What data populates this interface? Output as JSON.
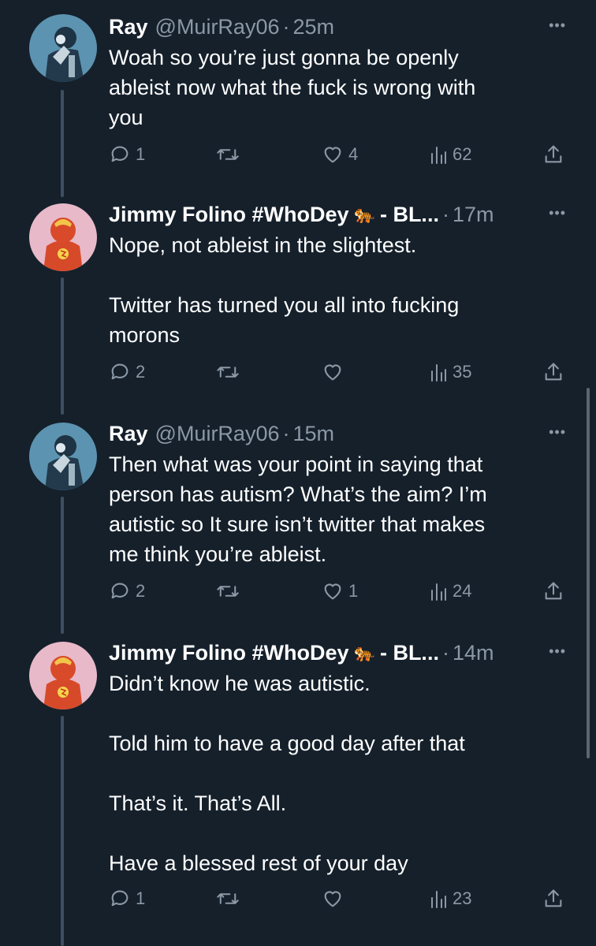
{
  "tweets": [
    {
      "name": "Ray",
      "handle": "@MuirRay06",
      "dot": "·",
      "time": "25m",
      "lines": [
        "Woah so you’re just gonna be openly",
        "ableist now what the fuck is wrong with",
        "you"
      ],
      "replies": "1",
      "retweets": "",
      "likes": "4",
      "views": "62"
    },
    {
      "name": "Jimmy Folino #WhoDey",
      "emoji": "🐅",
      "name_suffix": "- BL...",
      "dot": "·",
      "time": "17m",
      "lines": [
        "Nope, not ableist in the slightest.",
        "",
        "Twitter has turned you all into fucking",
        "morons"
      ],
      "replies": "2",
      "retweets": "",
      "likes": "",
      "views": "35"
    },
    {
      "name": "Ray",
      "handle": "@MuirRay06",
      "dot": "·",
      "time": "15m",
      "lines": [
        "Then what was your point in saying that",
        "person has autism? What’s the aim? I’m",
        "autistic so It sure isn’t twitter that makes",
        "me think you’re ableist."
      ],
      "replies": "2",
      "retweets": "",
      "likes": "1",
      "views": "24"
    },
    {
      "name": "Jimmy Folino #WhoDey",
      "emoji": "🐅",
      "name_suffix": "- BL...",
      "dot": "·",
      "time": "14m",
      "lines": [
        "Didn’t know he was autistic.",
        "",
        "Told him to have a good day after that",
        "",
        "That’s it. That’s All.",
        "",
        "Have a blessed rest of your day"
      ],
      "replies": "1",
      "retweets": "",
      "likes": "",
      "views": "23"
    }
  ],
  "more_icon": "•••"
}
